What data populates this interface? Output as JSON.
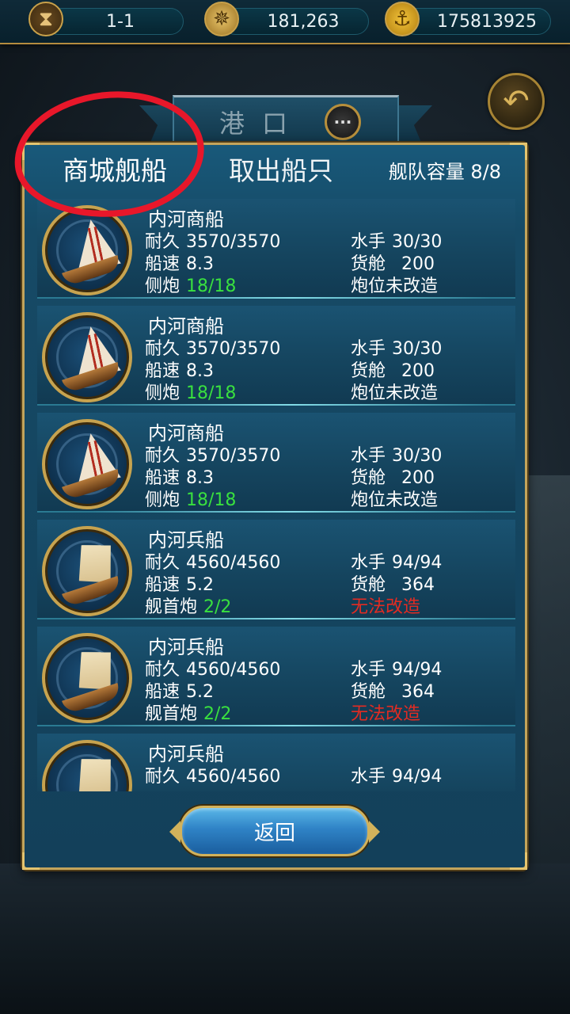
{
  "topbar": {
    "level": "1-1",
    "compass_value": "181,263",
    "gold_value": "175813925"
  },
  "port": {
    "title": "港口"
  },
  "panel": {
    "tabs": [
      "商城舰船",
      "取出船只"
    ],
    "capacity_label": "舰队容量 8/8",
    "return_label": "返回"
  },
  "ships": [
    {
      "name": "内河商船",
      "durability_label": "耐久",
      "durability": "3570/3570",
      "speed_label": "船速",
      "speed": "8.3",
      "cannon_label": "侧炮",
      "cannon": "18/18",
      "crew_label": "水手",
      "crew": "30/30",
      "cargo_label": "货舱",
      "cargo": "200",
      "mod_status": "炮位未改造",
      "type": "merchant"
    },
    {
      "name": "内河商船",
      "durability_label": "耐久",
      "durability": "3570/3570",
      "speed_label": "船速",
      "speed": "8.3",
      "cannon_label": "侧炮",
      "cannon": "18/18",
      "crew_label": "水手",
      "crew": "30/30",
      "cargo_label": "货舱",
      "cargo": "200",
      "mod_status": "炮位未改造",
      "type": "merchant"
    },
    {
      "name": "内河商船",
      "durability_label": "耐久",
      "durability": "3570/3570",
      "speed_label": "船速",
      "speed": "8.3",
      "cannon_label": "侧炮",
      "cannon": "18/18",
      "crew_label": "水手",
      "crew": "30/30",
      "cargo_label": "货舱",
      "cargo": "200",
      "mod_status": "炮位未改造",
      "type": "merchant"
    },
    {
      "name": "内河兵船",
      "durability_label": "耐久",
      "durability": "4560/4560",
      "speed_label": "船速",
      "speed": "5.2",
      "cannon_label": "舰首炮",
      "cannon": "2/2",
      "crew_label": "水手",
      "crew": "94/94",
      "cargo_label": "货舱",
      "cargo": "364",
      "mod_status": "无法改造",
      "type": "war"
    },
    {
      "name": "内河兵船",
      "durability_label": "耐久",
      "durability": "4560/4560",
      "speed_label": "船速",
      "speed": "5.2",
      "cannon_label": "舰首炮",
      "cannon": "2/2",
      "crew_label": "水手",
      "crew": "94/94",
      "cargo_label": "货舱",
      "cargo": "364",
      "mod_status": "无法改造",
      "type": "war"
    },
    {
      "name": "内河兵船",
      "durability_label": "耐久",
      "durability": "4560/4560",
      "crew_label": "水手",
      "crew": "94/94",
      "type": "war"
    }
  ]
}
